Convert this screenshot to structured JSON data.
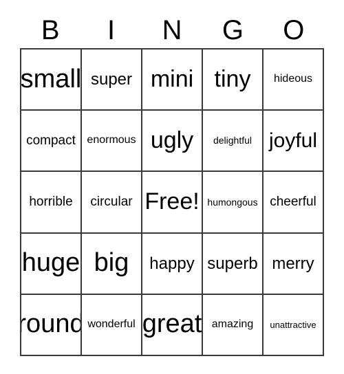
{
  "card": {
    "title_letters": [
      "B",
      "I",
      "N",
      "G",
      "O"
    ],
    "free_space_text": "Free!",
    "border_color": "#3a3a3a",
    "background_color": "#ffffff",
    "text_color": "#000000",
    "columns": 5,
    "rows": 5,
    "grid": [
      [
        {
          "text": "small",
          "size": "fs-xxl"
        },
        {
          "text": "super",
          "size": "fs-m"
        },
        {
          "text": "mini",
          "size": "fs-xl"
        },
        {
          "text": "tiny",
          "size": "fs-xl"
        },
        {
          "text": "hideous",
          "size": "fs-xs"
        }
      ],
      [
        {
          "text": "compact",
          "size": "fs-s"
        },
        {
          "text": "enormous",
          "size": "fs-xs"
        },
        {
          "text": "ugly",
          "size": "fs-xl"
        },
        {
          "text": "delightful",
          "size": "fs-xxs"
        },
        {
          "text": "joyful",
          "size": "fs-l"
        }
      ],
      [
        {
          "text": "horrible",
          "size": "fs-s"
        },
        {
          "text": "circular",
          "size": "fs-s"
        },
        {
          "text": "Free!",
          "size": "fs-xl"
        },
        {
          "text": "humongous",
          "size": "fs-xxs"
        },
        {
          "text": "cheerful",
          "size": "fs-s"
        }
      ],
      [
        {
          "text": "huge",
          "size": "fs-xxl"
        },
        {
          "text": "big",
          "size": "fs-xxl"
        },
        {
          "text": "happy",
          "size": "fs-m"
        },
        {
          "text": "superb",
          "size": "fs-m"
        },
        {
          "text": "merry",
          "size": "fs-m"
        }
      ],
      [
        {
          "text": "round",
          "size": "fs-xxl"
        },
        {
          "text": "wonderful",
          "size": "fs-xs"
        },
        {
          "text": "great",
          "size": "fs-xxl"
        },
        {
          "text": "amazing",
          "size": "fs-xs"
        },
        {
          "text": "unattractive",
          "size": "fs-min"
        }
      ]
    ]
  }
}
